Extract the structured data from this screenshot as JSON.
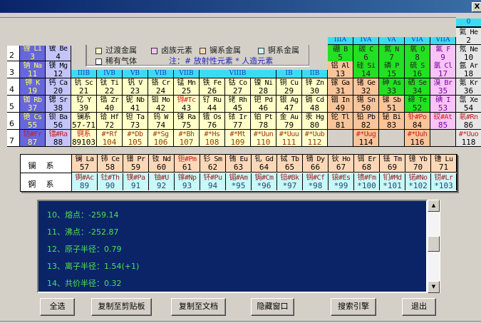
{
  "window": {
    "close_label": "X"
  },
  "legend": {
    "items": [
      {
        "label": "过渡金属",
        "color": "#ffffc8"
      },
      {
        "label": "卤族元素",
        "color": "#f8c4f8"
      },
      {
        "label": "镧系金属",
        "color": "#fcd8b8"
      },
      {
        "label": "锕系金属",
        "color": "#c8f8f8"
      },
      {
        "label": "稀有气体",
        "color": "#ffffff"
      }
    ],
    "note": "注：# 放射性元素  * 人造元素"
  },
  "periods": [
    "2",
    "3",
    "4",
    "5",
    "6",
    "7"
  ],
  "group_headers": {
    "top_zero": "0",
    "a": [
      "IIIA",
      "IVA",
      "VA",
      "VIA",
      "VIIA"
    ],
    "b": [
      {
        "label": "IIIB",
        "span": 1
      },
      {
        "label": "IVB",
        "span": 1
      },
      {
        "label": "VB",
        "span": 1
      },
      {
        "label": "VIB",
        "span": 1
      },
      {
        "label": "VIIB",
        "span": 1
      },
      {
        "label": "VIIIB",
        "span": 3
      },
      {
        "label": "IB",
        "span": 1
      },
      {
        "label": "IIB",
        "span": 1
      }
    ]
  },
  "elements": [
    {
      "p": 1,
      "g": 18,
      "name": "氦 He",
      "no": "2",
      "cat": "noble"
    },
    {
      "p": 2,
      "g": 1,
      "name": "锂 Li",
      "no": "3",
      "cat": "alkali"
    },
    {
      "p": 2,
      "g": 2,
      "name": "铍 Be",
      "no": "4",
      "cat": "alkaline"
    },
    {
      "p": 2,
      "g": 13,
      "name": "硼 B",
      "no": "5",
      "cat": "nonmetal"
    },
    {
      "p": 2,
      "g": 14,
      "name": "碳 C",
      "no": "6",
      "cat": "nonmetal"
    },
    {
      "p": 2,
      "g": 15,
      "name": "氮 N",
      "no": "7",
      "cat": "nonmetal"
    },
    {
      "p": 2,
      "g": 16,
      "name": "氧 O",
      "no": "8",
      "cat": "nonmetal"
    },
    {
      "p": 2,
      "g": 17,
      "name": "氟 F",
      "no": "9",
      "cat": "halogen"
    },
    {
      "p": 2,
      "g": 18,
      "name": "氖 Ne",
      "no": "10",
      "cat": "noble"
    },
    {
      "p": 3,
      "g": 1,
      "name": "钠 Na",
      "no": "11",
      "cat": "alkali"
    },
    {
      "p": 3,
      "g": 2,
      "name": "镁 Mg",
      "no": "12",
      "cat": "alkaline"
    },
    {
      "p": 3,
      "g": 13,
      "name": "铝 Al",
      "no": "13",
      "cat": "poor"
    },
    {
      "p": 3,
      "g": 14,
      "name": "硅 Si",
      "no": "14",
      "cat": "nonmetal"
    },
    {
      "p": 3,
      "g": 15,
      "name": "磷 P",
      "no": "15",
      "cat": "nonmetal"
    },
    {
      "p": 3,
      "g": 16,
      "name": "硫 S",
      "no": "16",
      "cat": "nonmetal"
    },
    {
      "p": 3,
      "g": 17,
      "name": "氯 Cl",
      "no": "17",
      "cat": "halogen"
    },
    {
      "p": 3,
      "g": 18,
      "name": "氩 Ar",
      "no": "18",
      "cat": "noble"
    },
    {
      "p": 4,
      "g": 1,
      "name": "钾 K",
      "no": "19",
      "cat": "alkali"
    },
    {
      "p": 4,
      "g": 2,
      "name": "钙 Ca",
      "no": "20",
      "cat": "alkaline"
    },
    {
      "p": 4,
      "g": 3,
      "name": "钪 Sc",
      "no": "21",
      "cat": "transition"
    },
    {
      "p": 4,
      "g": 4,
      "name": "钛 Ti",
      "no": "22",
      "cat": "transition"
    },
    {
      "p": 4,
      "g": 5,
      "name": "钒 V",
      "no": "23",
      "cat": "transition"
    },
    {
      "p": 4,
      "g": 6,
      "name": "铬 Cr",
      "no": "24",
      "cat": "transition"
    },
    {
      "p": 4,
      "g": 7,
      "name": "锰 Mn",
      "no": "25",
      "cat": "transition"
    },
    {
      "p": 4,
      "g": 8,
      "name": "铁 Fe",
      "no": "26",
      "cat": "transition"
    },
    {
      "p": 4,
      "g": 9,
      "name": "钴 Co",
      "no": "27",
      "cat": "transition"
    },
    {
      "p": 4,
      "g": 10,
      "name": "镍 Ni",
      "no": "28",
      "cat": "transition"
    },
    {
      "p": 4,
      "g": 11,
      "name": "铜 Cu",
      "no": "29",
      "cat": "transition"
    },
    {
      "p": 4,
      "g": 12,
      "name": "锌 Zn",
      "no": "30",
      "cat": "transition"
    },
    {
      "p": 4,
      "g": 13,
      "name": "镓 Ga",
      "no": "31",
      "cat": "poor"
    },
    {
      "p": 4,
      "g": 14,
      "name": "锗 Ge",
      "no": "32",
      "cat": "poor"
    },
    {
      "p": 4,
      "g": 15,
      "name": "砷 As",
      "no": "33",
      "cat": "nonmetal"
    },
    {
      "p": 4,
      "g": 16,
      "name": "硒 Se",
      "no": "34",
      "cat": "nonmetal"
    },
    {
      "p": 4,
      "g": 17,
      "name": "溴 Br",
      "no": "35",
      "cat": "halogen"
    },
    {
      "p": 4,
      "g": 18,
      "name": "氪 Kr",
      "no": "36",
      "cat": "noble"
    },
    {
      "p": 5,
      "g": 1,
      "name": "铷 Rb",
      "no": "37",
      "cat": "alkali"
    },
    {
      "p": 5,
      "g": 2,
      "name": "锶 Sr",
      "no": "38",
      "cat": "alkaline"
    },
    {
      "p": 5,
      "g": 3,
      "name": "钇 Y",
      "no": "39",
      "cat": "transition"
    },
    {
      "p": 5,
      "g": 4,
      "name": "锆 Zr",
      "no": "40",
      "cat": "transition"
    },
    {
      "p": 5,
      "g": 5,
      "name": "铌 Nb",
      "no": "41",
      "cat": "transition"
    },
    {
      "p": 5,
      "g": 6,
      "name": "钼 Mo",
      "no": "42",
      "cat": "transition"
    },
    {
      "p": 5,
      "g": 7,
      "name": "锝#Tc",
      "no": "43",
      "cat": "transition",
      "radio": true
    },
    {
      "p": 5,
      "g": 8,
      "name": "钌 Ru",
      "no": "44",
      "cat": "transition"
    },
    {
      "p": 5,
      "g": 9,
      "name": "铑 Rh",
      "no": "45",
      "cat": "transition"
    },
    {
      "p": 5,
      "g": 10,
      "name": "钯 Pd",
      "no": "46",
      "cat": "transition"
    },
    {
      "p": 5,
      "g": 11,
      "name": "银 Ag",
      "no": "47",
      "cat": "transition"
    },
    {
      "p": 5,
      "g": 12,
      "name": "镉 Cd",
      "no": "48",
      "cat": "transition"
    },
    {
      "p": 5,
      "g": 13,
      "name": "铟 In",
      "no": "49",
      "cat": "poor"
    },
    {
      "p": 5,
      "g": 14,
      "name": "锡 Sn",
      "no": "50",
      "cat": "poor"
    },
    {
      "p": 5,
      "g": 15,
      "name": "锑 Sb",
      "no": "51",
      "cat": "poor"
    },
    {
      "p": 5,
      "g": 16,
      "name": "碲 Te",
      "no": "52",
      "cat": "nonmetal"
    },
    {
      "p": 5,
      "g": 17,
      "name": "碘 I",
      "no": "53",
      "cat": "halogen"
    },
    {
      "p": 5,
      "g": 18,
      "name": "氙 Xe",
      "no": "54",
      "cat": "noble"
    },
    {
      "p": 6,
      "g": 1,
      "name": "铯 Cs",
      "no": "55",
      "cat": "alkali"
    },
    {
      "p": 6,
      "g": 2,
      "name": "钡 Ba",
      "no": "56",
      "cat": "alkaline"
    },
    {
      "p": 6,
      "g": 3,
      "name": "镧系",
      "no": "57-71",
      "cat": "transition"
    },
    {
      "p": 6,
      "g": 4,
      "name": "铪 Hf",
      "no": "72",
      "cat": "transition"
    },
    {
      "p": 6,
      "g": 5,
      "name": "钽 Ta",
      "no": "73",
      "cat": "transition"
    },
    {
      "p": 6,
      "g": 6,
      "name": "钨 W",
      "no": "74",
      "cat": "transition"
    },
    {
      "p": 6,
      "g": 7,
      "name": "铼 Ra",
      "no": "75",
      "cat": "transition"
    },
    {
      "p": 6,
      "g": 8,
      "name": "锇 Os",
      "no": "76",
      "cat": "transition"
    },
    {
      "p": 6,
      "g": 9,
      "name": "铱 Ir",
      "no": "77",
      "cat": "transition"
    },
    {
      "p": 6,
      "g": 10,
      "name": "铂 Pt",
      "no": "78",
      "cat": "transition"
    },
    {
      "p": 6,
      "g": 11,
      "name": "金 Au",
      "no": "79",
      "cat": "transition"
    },
    {
      "p": 6,
      "g": 12,
      "name": "汞 Hg",
      "no": "80",
      "cat": "transition"
    },
    {
      "p": 6,
      "g": 13,
      "name": "铊 Tl",
      "no": "81",
      "cat": "poor"
    },
    {
      "p": 6,
      "g": 14,
      "name": "铅 Pb",
      "no": "82",
      "cat": "poor"
    },
    {
      "p": 6,
      "g": 15,
      "name": "铋 Bi",
      "no": "83",
      "cat": "poor"
    },
    {
      "p": 6,
      "g": 16,
      "name": "钋#Po",
      "no": "84",
      "cat": "poor",
      "radio": true
    },
    {
      "p": 6,
      "g": 17,
      "name": "砹#At",
      "no": "85",
      "cat": "halogen",
      "radio": true
    },
    {
      "p": 6,
      "g": 18,
      "name": "氡#Rn",
      "no": "86",
      "cat": "noble",
      "radio": true
    },
    {
      "p": 7,
      "g": 1,
      "name": "钫#Fr",
      "no": "87",
      "cat": "alkali",
      "radio": true
    },
    {
      "p": 7,
      "g": 2,
      "name": "镭#Ra",
      "no": "88",
      "cat": "alkaline",
      "radio": true
    },
    {
      "p": 7,
      "g": 3,
      "name": "锕系",
      "no": "89103",
      "cat": "transition",
      "radio": true
    },
    {
      "p": 7,
      "g": 4,
      "name": "#*Rf",
      "no": "104",
      "cat": "transition7"
    },
    {
      "p": 7,
      "g": 5,
      "name": "#*Db",
      "no": "105",
      "cat": "transition7"
    },
    {
      "p": 7,
      "g": 6,
      "name": "#*Sg",
      "no": "106",
      "cat": "transition7"
    },
    {
      "p": 7,
      "g": 7,
      "name": "#*Bh",
      "no": "107",
      "cat": "transition7"
    },
    {
      "p": 7,
      "g": 8,
      "name": "#*Hs",
      "no": "108",
      "cat": "transition7"
    },
    {
      "p": 7,
      "g": 9,
      "name": "#*Mt",
      "no": "109",
      "cat": "transition7"
    },
    {
      "p": 7,
      "g": 10,
      "name": "#*Uun",
      "no": "110",
      "cat": "transition7"
    },
    {
      "p": 7,
      "g": 11,
      "name": "#*Uuu",
      "no": "111",
      "cat": "transition7"
    },
    {
      "p": 7,
      "g": 12,
      "name": "#*Uub",
      "no": "112",
      "cat": "transition7"
    },
    {
      "p": 7,
      "g": 13,
      "name": "",
      "no": "",
      "cat": "empty"
    },
    {
      "p": 7,
      "g": 14,
      "name": "#*Uug",
      "no": "114",
      "cat": "poor",
      "radio": true
    },
    {
      "p": 7,
      "g": 15,
      "name": "",
      "no": "",
      "cat": "empty"
    },
    {
      "p": 7,
      "g": 16,
      "name": "#*Uuh",
      "no": "116",
      "cat": "poor",
      "radio": true
    },
    {
      "p": 7,
      "g": 17,
      "name": "",
      "no": "",
      "cat": "empty"
    },
    {
      "p": 7,
      "g": 18,
      "name": "#*Uuo",
      "no": "118",
      "cat": "noble",
      "radio": true
    }
  ],
  "lanthanide_label": "镧系",
  "actinide_label": "锕系",
  "lanthanides": [
    {
      "name": "镧 La",
      "no": "57"
    },
    {
      "name": "铈 Ce",
      "no": "58"
    },
    {
      "name": "镨 Pr",
      "no": "59"
    },
    {
      "name": "钕 Nd",
      "no": "60"
    },
    {
      "name": "钷#Pm",
      "no": "61",
      "radio": true
    },
    {
      "name": "钐 Sm",
      "no": "62"
    },
    {
      "name": "铕 Eu",
      "no": "63"
    },
    {
      "name": "钆 Gd",
      "no": "64"
    },
    {
      "name": "铽 Tb",
      "no": "65"
    },
    {
      "name": "镝 Dy",
      "no": "66"
    },
    {
      "name": "钬 Ho",
      "no": "67"
    },
    {
      "name": "铒 Er",
      "no": "68"
    },
    {
      "name": "铥 Tm",
      "no": "69"
    },
    {
      "name": "镱 Yb",
      "no": "70"
    },
    {
      "name": "镥 Lu",
      "no": "71"
    }
  ],
  "actinides": [
    {
      "name": "锕#Ac",
      "no": "89"
    },
    {
      "name": "钍#Th",
      "no": "90"
    },
    {
      "name": "镤#Pa",
      "no": "91"
    },
    {
      "name": "铀#U",
      "no": "92"
    },
    {
      "name": "镎#Np",
      "no": "93"
    },
    {
      "name": "钚#Pu",
      "no": "94"
    },
    {
      "name": "镅#Am",
      "no": "*95"
    },
    {
      "name": "锔#Cm",
      "no": "*96"
    },
    {
      "name": "锫#Bk",
      "no": "*97"
    },
    {
      "name": "锎#Cf",
      "no": "*98"
    },
    {
      "name": "锿#Es",
      "no": "*99"
    },
    {
      "name": "镄#Fm",
      "no": "*100"
    },
    {
      "name": "钔#Md",
      "no": "*101"
    },
    {
      "name": "锘#No",
      "no": "*102"
    },
    {
      "name": "铹#Lr",
      "no": "*103"
    }
  ],
  "info": {
    "lines": [
      "10、熔点：-259.14",
      "11、沸点：-252.87",
      "12、原子半径：0.79",
      "13、离子半径：1.54(+1)",
      "14、共价半径：0.32"
    ]
  },
  "buttons": [
    "全选",
    "复制至剪贴板",
    "复制至文档",
    "隐藏窗口",
    "搜索引擎",
    "退出"
  ],
  "scrollbar": {
    "position_fraction": 0.45
  }
}
